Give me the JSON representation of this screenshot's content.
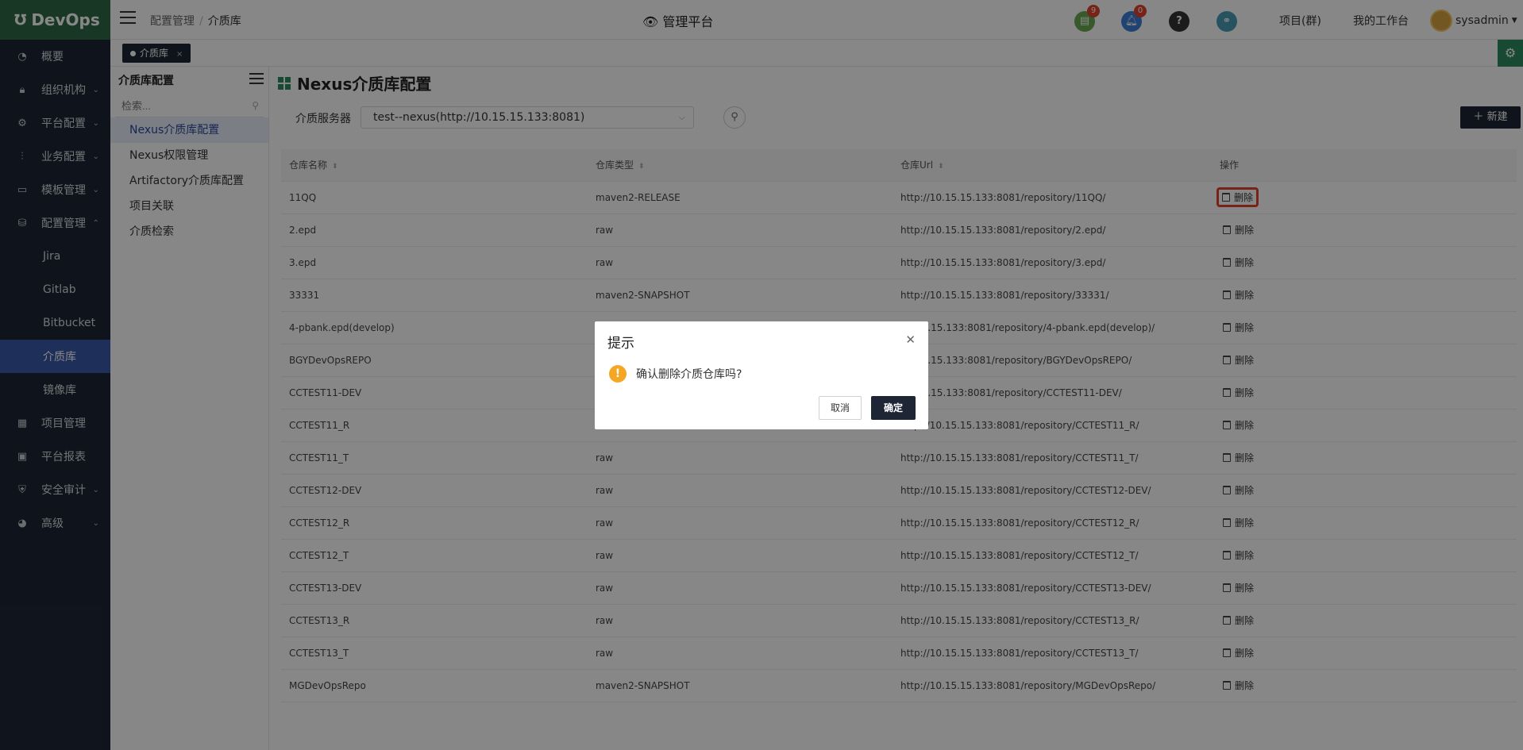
{
  "brand": {
    "name": "DevOps",
    "logo_icon": "devops-logo-icon"
  },
  "nav": [
    {
      "label": "概要",
      "icon": "dashboard-icon",
      "chevron": ""
    },
    {
      "label": "组织机构",
      "icon": "lock-icon",
      "chevron": "⌄"
    },
    {
      "label": "平台配置",
      "icon": "gear-icon",
      "chevron": "⌄"
    },
    {
      "label": "业务配置",
      "icon": "sliders-icon",
      "chevron": "⌄"
    },
    {
      "label": "模板管理",
      "icon": "template-icon",
      "chevron": "⌄"
    },
    {
      "label": "配置管理",
      "icon": "database-icon",
      "chevron": "⌃"
    }
  ],
  "nav_sub": [
    {
      "label": "Jira",
      "active": false
    },
    {
      "label": "Gitlab",
      "active": false
    },
    {
      "label": "Bitbucket",
      "active": false
    },
    {
      "label": "介质库",
      "active": true
    },
    {
      "label": "镜像库",
      "active": false
    }
  ],
  "nav_tail": [
    {
      "label": "项目管理",
      "icon": "grid-icon",
      "chevron": ""
    },
    {
      "label": "平台报表",
      "icon": "monitor-icon",
      "chevron": ""
    },
    {
      "label": "安全审计",
      "icon": "shield-icon",
      "chevron": "⌄"
    },
    {
      "label": "高级",
      "icon": "palette-icon",
      "chevron": "⌄"
    }
  ],
  "header": {
    "breadcrumb": [
      "配置管理",
      "介质库"
    ],
    "title": "管理平台",
    "badge_tasks": "9",
    "badge_notify": "0",
    "project_link": "项目(群)",
    "workbench_link": "我的工作台",
    "username": "sysadmin"
  },
  "tabs": [
    {
      "label": "介质库"
    }
  ],
  "subside": {
    "title": "介质库配置",
    "search_placeholder": "检索...",
    "items": [
      {
        "label": "Nexus介质库配置",
        "active": true
      },
      {
        "label": "Nexus权限管理",
        "active": false
      },
      {
        "label": "Artifactory介质库配置",
        "active": false
      },
      {
        "label": "项目关联",
        "active": false
      },
      {
        "label": "介质检索",
        "active": false
      }
    ]
  },
  "main": {
    "title": "Nexus介质库配置",
    "filter_label": "介质服务器",
    "filter_value": "test--nexus(http://10.15.15.133:8081)",
    "new_button": "新建",
    "columns": [
      "仓库名称",
      "仓库类型",
      "仓库Url",
      "操作"
    ],
    "delete_label": "删除",
    "rows": [
      {
        "name": "11QQ",
        "type": "maven2-RELEASE",
        "url": "http://10.15.15.133:8081/repository/11QQ/"
      },
      {
        "name": "2.epd",
        "type": "raw",
        "url": "http://10.15.15.133:8081/repository/2.epd/"
      },
      {
        "name": "3.epd",
        "type": "raw",
        "url": "http://10.15.15.133:8081/repository/3.epd/"
      },
      {
        "name": "33331",
        "type": "maven2-SNAPSHOT",
        "url": "http://10.15.15.133:8081/repository/33331/"
      },
      {
        "name": "4-pbank.epd(develop)",
        "type": "",
        "url": "10.15.15.133:8081/repository/4-pbank.epd(develop)/"
      },
      {
        "name": "BGYDevOpsREPO",
        "type": "",
        "url": "10.15.15.133:8081/repository/BGYDevOpsREPO/"
      },
      {
        "name": "CCTEST11-DEV",
        "type": "",
        "url": "10.15.15.133:8081/repository/CCTEST11-DEV/"
      },
      {
        "name": "CCTEST11_R",
        "type": "raw",
        "url": "http://10.15.15.133:8081/repository/CCTEST11_R/"
      },
      {
        "name": "CCTEST11_T",
        "type": "raw",
        "url": "http://10.15.15.133:8081/repository/CCTEST11_T/"
      },
      {
        "name": "CCTEST12-DEV",
        "type": "raw",
        "url": "http://10.15.15.133:8081/repository/CCTEST12-DEV/"
      },
      {
        "name": "CCTEST12_R",
        "type": "raw",
        "url": "http://10.15.15.133:8081/repository/CCTEST12_R/"
      },
      {
        "name": "CCTEST12_T",
        "type": "raw",
        "url": "http://10.15.15.133:8081/repository/CCTEST12_T/"
      },
      {
        "name": "CCTEST13-DEV",
        "type": "raw",
        "url": "http://10.15.15.133:8081/repository/CCTEST13-DEV/"
      },
      {
        "name": "CCTEST13_R",
        "type": "raw",
        "url": "http://10.15.15.133:8081/repository/CCTEST13_R/"
      },
      {
        "name": "CCTEST13_T",
        "type": "raw",
        "url": "http://10.15.15.133:8081/repository/CCTEST13_T/"
      },
      {
        "name": "MGDevOpsRepo",
        "type": "maven2-SNAPSHOT",
        "url": "http://10.15.15.133:8081/repository/MGDevOpsRepo/"
      }
    ]
  },
  "modal": {
    "title": "提示",
    "message": "确认删除介质仓库吗?",
    "cancel": "取消",
    "confirm": "确定"
  },
  "colors": {
    "brand_green": "#2e6b46",
    "nav_bg": "#1e2636",
    "active_blue": "#3a59a8",
    "highlight_red": "#e0432f"
  }
}
